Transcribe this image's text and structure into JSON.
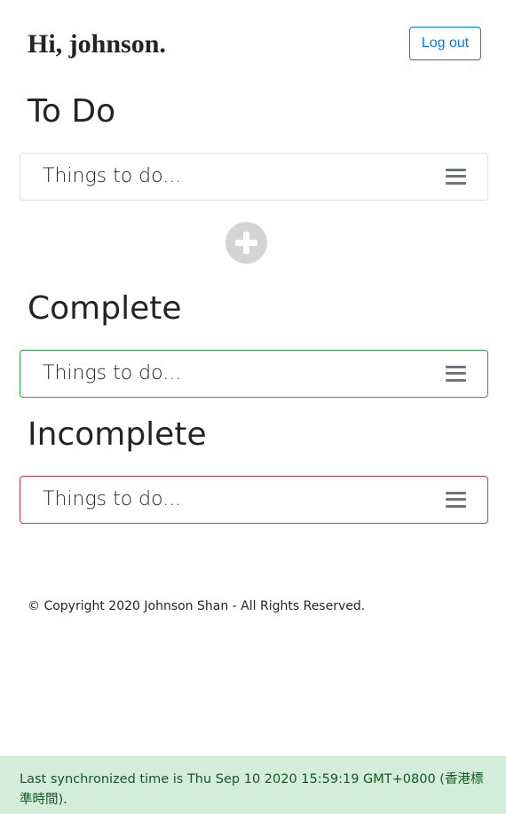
{
  "header": {
    "greeting": "Hi, johnson.",
    "logout_label": "Log out"
  },
  "sections": {
    "todo": {
      "title": "To Do",
      "card_text": "Things to do..."
    },
    "complete": {
      "title": "Complete",
      "card_text": "Things to do..."
    },
    "incomplete": {
      "title": "Incomplete",
      "card_text": "Things to do..."
    }
  },
  "icons": {
    "menu": "hamburger-menu-icon",
    "add": "plus-circle-icon"
  },
  "colors": {
    "complete_border": "#28a745",
    "incomplete_border": "#dc3545",
    "logout": "#007bff",
    "sync_bg": "#d4edda"
  },
  "footer": {
    "copyright": "© Copyright 2020 Johnson Shan - All Rights Reserved."
  },
  "status": {
    "sync_message": "Last synchronized time is Thu Sep 10 2020 15:59:19 GMT+0800 (香港標準時間)."
  }
}
